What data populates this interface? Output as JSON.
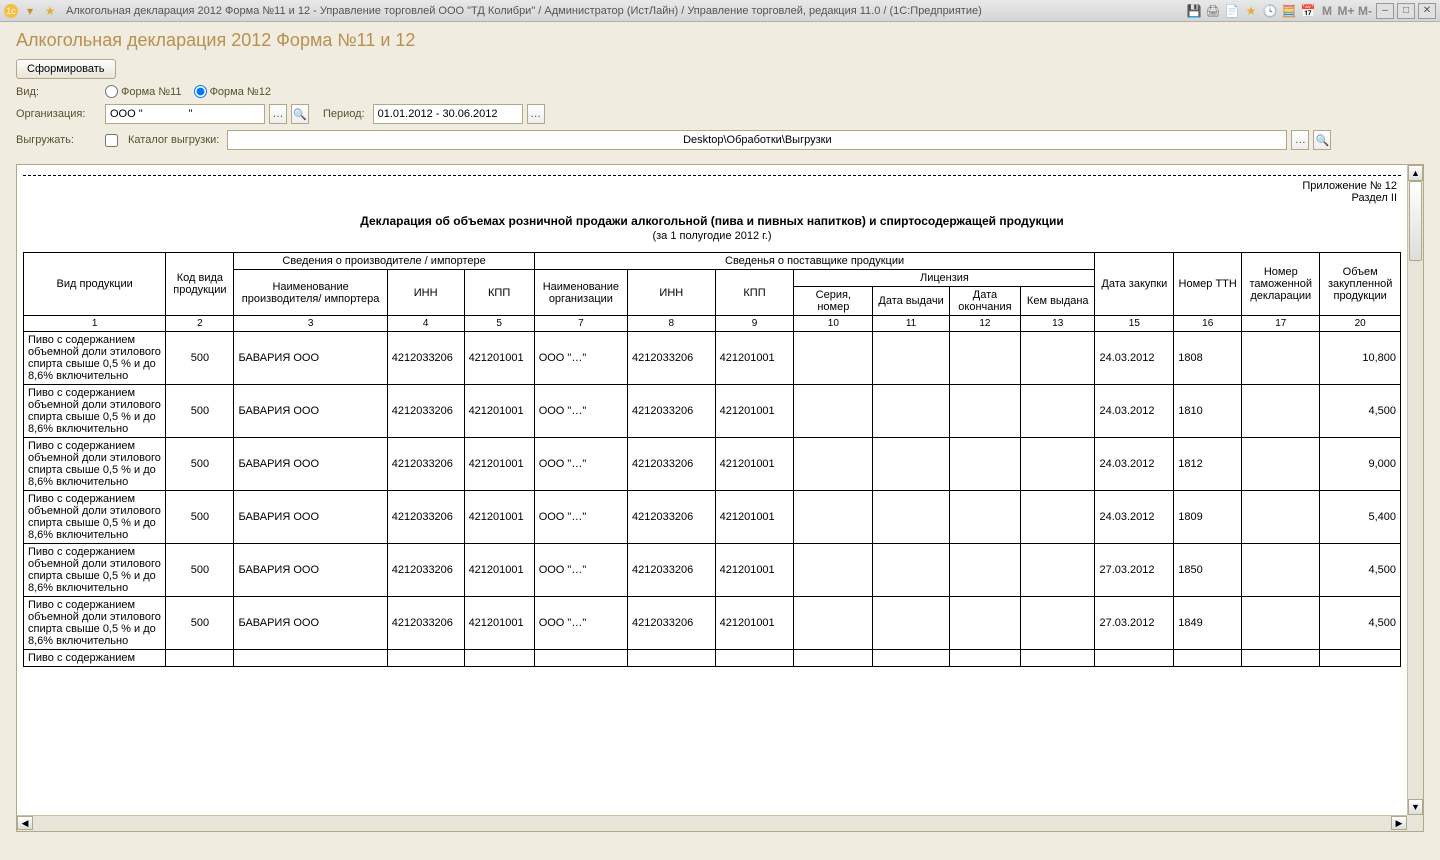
{
  "titlebar": {
    "text": "Алкогольная декларация 2012 Форма №11 и 12 - Управление торговлей ООО \"ТД Колибри\" / Администратор (ИстЛайн) / Управление торговлей, редакция 11.0 / (1С:Предприятие)",
    "m_labels": {
      "m": "M",
      "mplus": "M+",
      "mminus": "M-"
    }
  },
  "page": {
    "title": "Алкогольная декларация 2012 Форма №11 и 12",
    "buttons": {
      "generate": "Сформировать"
    }
  },
  "form": {
    "labels": {
      "view": "Вид:",
      "form11": "Форма №11",
      "form12": "Форма №12",
      "org": "Организация:",
      "period": "Период:",
      "export": "Выгружать:",
      "export_dir": "Каталог выгрузки:"
    },
    "values": {
      "org": "ООО \"               \"",
      "period": "01.01.2012 - 30.06.2012",
      "export_path": "Desktop\\Обработки\\Выгрузки"
    },
    "radio_selected": "form12"
  },
  "report": {
    "meta_app": "Приложение № 12",
    "meta_section": "Раздел II",
    "heading": "Декларация об объемах розничной продажи алкогольной (пива и пивных напитков) и спиртосодержащей продукции",
    "subheading": "(за 1 полугодие 2012 г.)"
  },
  "table": {
    "headers": {
      "product_type": "Вид продукции",
      "product_code": "Код вида продукции",
      "producer_info": "Сведения о производителе / импортере",
      "producer_name": "Наименование производителя/ импортера",
      "inn": "ИНН",
      "kpp": "КПП",
      "supplier_info": "Сведенья о поставщике продукции",
      "supplier_name": "Наименование организации",
      "license": "Лицензия",
      "license_num": "Серия, номер",
      "license_issued": "Дата выдачи",
      "license_end": "Дата окончания",
      "license_by": "Кем выдана",
      "purchase_date": "Дата закупки",
      "ttn": "Номер ТТН",
      "customs_decl": "Номер таможенной декларации",
      "volume": "Объем закупленной продукции"
    },
    "col_nums": [
      "1",
      "2",
      "3",
      "4",
      "5",
      "7",
      "8",
      "9",
      "10",
      "11",
      "12",
      "13",
      "15",
      "16",
      "17",
      "20"
    ],
    "rows": [
      {
        "type": "Пиво с содержанием объемной доли этилового спирта свыше 0,5 % и до 8,6% включительно",
        "code": "500",
        "prod": "БАВАРИЯ ООО",
        "pinn": "4212033206",
        "pkpp": "421201001",
        "sup": "ООО \"…\"",
        "sinn": "4212033206",
        "skpp": "421201001",
        "ln": "",
        "li": "",
        "le": "",
        "lb": "",
        "date": "24.03.2012",
        "ttn": "1808",
        "cust": "",
        "vol": "10,800"
      },
      {
        "type": "Пиво с содержанием объемной доли этилового спирта свыше 0,5 % и до 8,6% включительно",
        "code": "500",
        "prod": "БАВАРИЯ ООО",
        "pinn": "4212033206",
        "pkpp": "421201001",
        "sup": "ООО \"…\"",
        "sinn": "4212033206",
        "skpp": "421201001",
        "ln": "",
        "li": "",
        "le": "",
        "lb": "",
        "date": "24.03.2012",
        "ttn": "1810",
        "cust": "",
        "vol": "4,500"
      },
      {
        "type": "Пиво с содержанием объемной доли этилового спирта свыше 0,5 % и до 8,6% включительно",
        "code": "500",
        "prod": "БАВАРИЯ ООО",
        "pinn": "4212033206",
        "pkpp": "421201001",
        "sup": "ООО \"…\"",
        "sinn": "4212033206",
        "skpp": "421201001",
        "ln": "",
        "li": "",
        "le": "",
        "lb": "",
        "date": "24.03.2012",
        "ttn": "1812",
        "cust": "",
        "vol": "9,000"
      },
      {
        "type": "Пиво с содержанием объемной доли этилового спирта свыше 0,5 % и до 8,6% включительно",
        "code": "500",
        "prod": "БАВАРИЯ ООО",
        "pinn": "4212033206",
        "pkpp": "421201001",
        "sup": "ООО \"…\"",
        "sinn": "4212033206",
        "skpp": "421201001",
        "ln": "",
        "li": "",
        "le": "",
        "lb": "",
        "date": "24.03.2012",
        "ttn": "1809",
        "cust": "",
        "vol": "5,400"
      },
      {
        "type": "Пиво с содержанием объемной доли этилового спирта свыше 0,5 % и до 8,6% включительно",
        "code": "500",
        "prod": "БАВАРИЯ ООО",
        "pinn": "4212033206",
        "pkpp": "421201001",
        "sup": "ООО \"…\"",
        "sinn": "4212033206",
        "skpp": "421201001",
        "ln": "",
        "li": "",
        "le": "",
        "lb": "",
        "date": "27.03.2012",
        "ttn": "1850",
        "cust": "",
        "vol": "4,500"
      },
      {
        "type": "Пиво с содержанием объемной доли этилового спирта свыше 0,5 % и до 8,6% включительно",
        "code": "500",
        "prod": "БАВАРИЯ ООО",
        "pinn": "4212033206",
        "pkpp": "421201001",
        "sup": "ООО \"…\"",
        "sinn": "4212033206",
        "skpp": "421201001",
        "ln": "",
        "li": "",
        "le": "",
        "lb": "",
        "date": "27.03.2012",
        "ttn": "1849",
        "cust": "",
        "vol": "4,500"
      },
      {
        "type": "Пиво с содержанием",
        "code": "",
        "prod": "",
        "pinn": "",
        "pkpp": "",
        "sup": "",
        "sinn": "",
        "skpp": "",
        "ln": "",
        "li": "",
        "le": "",
        "lb": "",
        "date": "",
        "ttn": "",
        "cust": "",
        "vol": ""
      }
    ]
  }
}
